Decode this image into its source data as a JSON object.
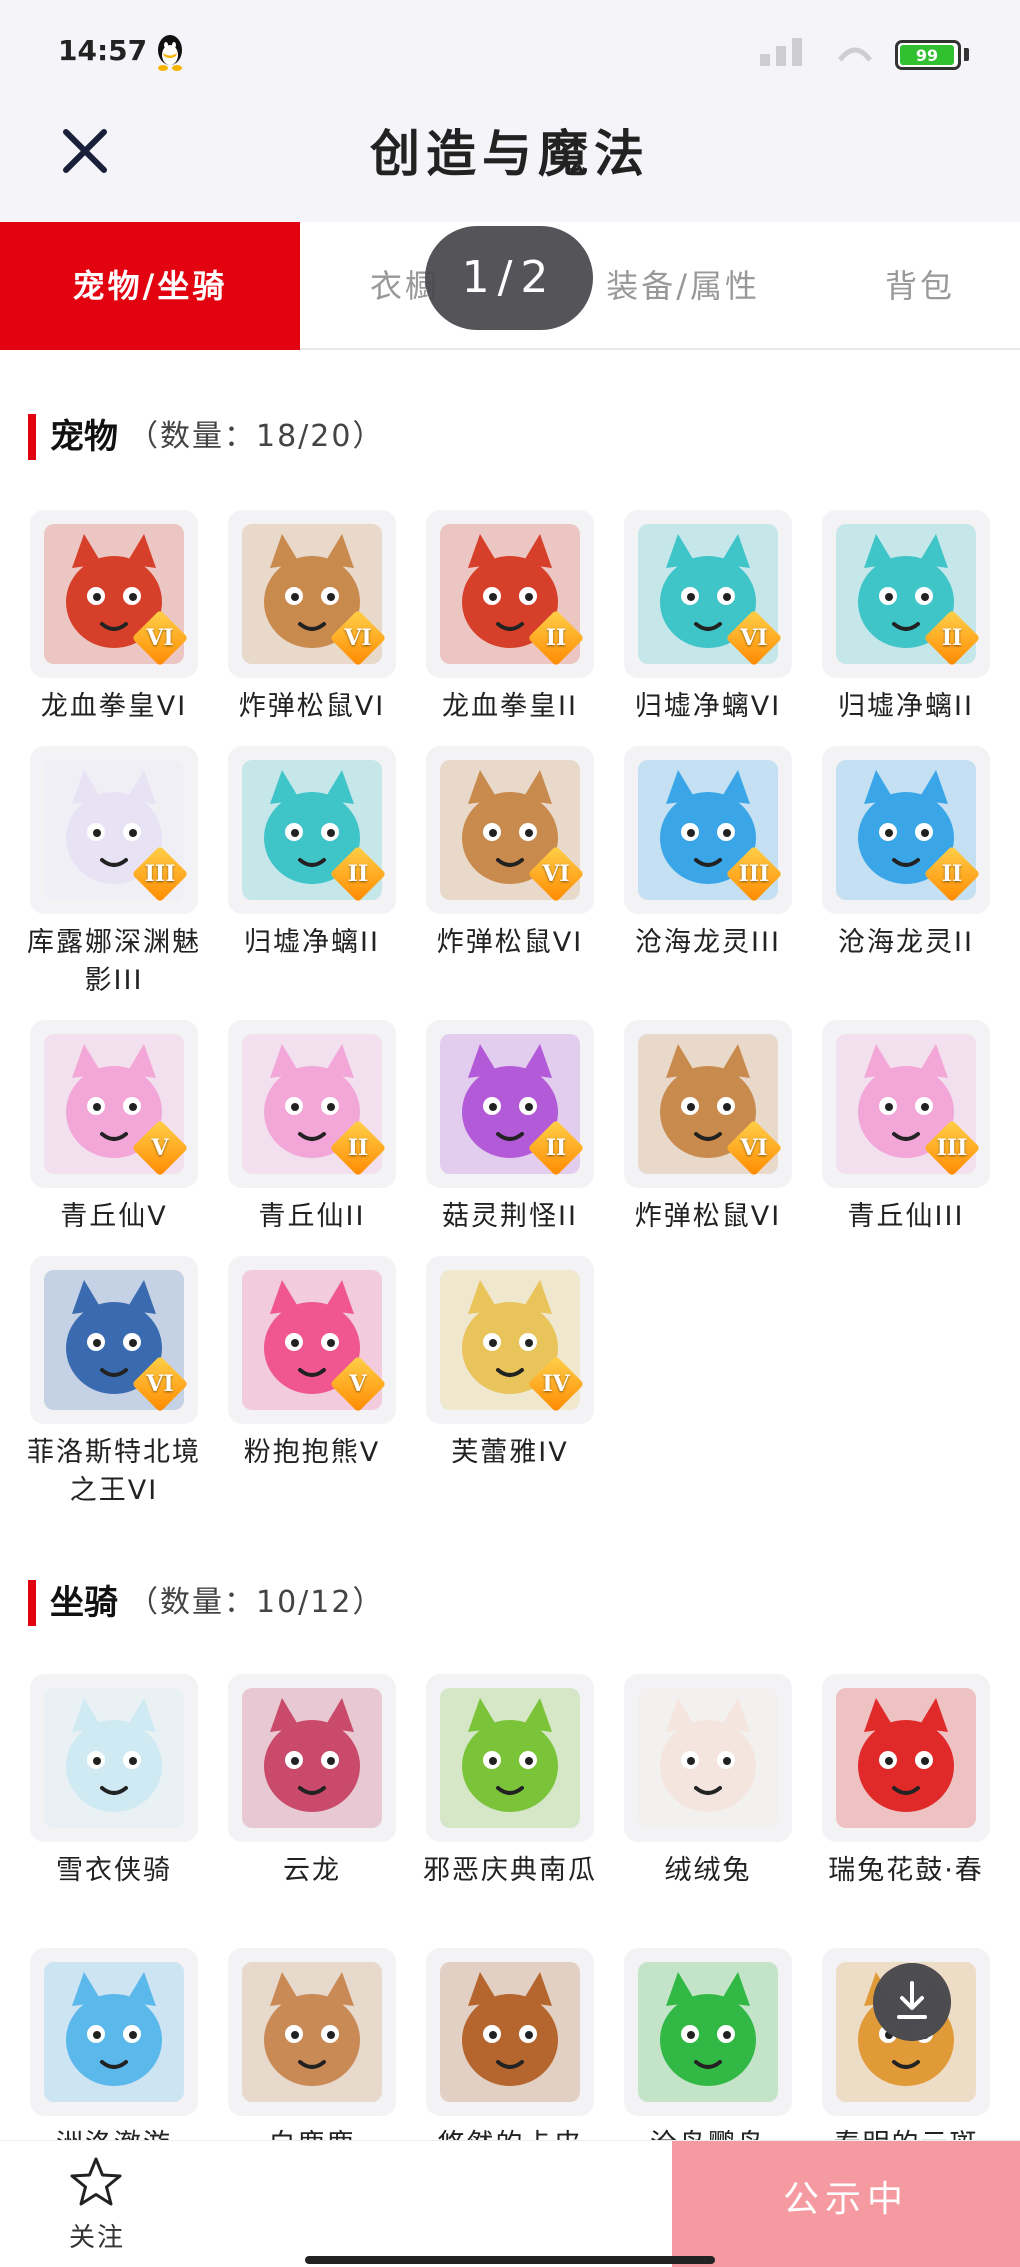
{
  "status_bar": {
    "time": "14:57",
    "battery": "99"
  },
  "header": {
    "title": "创造与魔法"
  },
  "tabs": [
    {
      "label": "宠物/坐骑",
      "active": true
    },
    {
      "label": "衣橱",
      "active": false
    },
    {
      "label": "装备/属性",
      "active": false
    },
    {
      "label": "背包",
      "active": false
    }
  ],
  "page_indicator": "1/2",
  "sections": {
    "pets": {
      "title": "宠物",
      "count": "（数量：18/20）",
      "items": [
        {
          "name": "龙血拳皇VI",
          "badge": "VI",
          "icon": "red-dragon-beast-icon",
          "color": "#d6402a"
        },
        {
          "name": "炸弹松鼠VI",
          "badge": "VI",
          "icon": "bomb-squirrel-icon",
          "color": "#c98a4d"
        },
        {
          "name": "龙血拳皇II",
          "badge": "II",
          "icon": "red-dragon-beast-icon",
          "color": "#d6402a"
        },
        {
          "name": "归墟净螭VI",
          "badge": "VI",
          "icon": "cyan-dragon-icon",
          "color": "#3fc4c8"
        },
        {
          "name": "归墟净螭II",
          "badge": "II",
          "icon": "cyan-dragon-icon",
          "color": "#3fc4c8"
        },
        {
          "name": "库露娜深渊魅影III",
          "badge": "III",
          "icon": "white-sprite-icon",
          "color": "#e8e2f5"
        },
        {
          "name": "归墟净螭II",
          "badge": "II",
          "icon": "cyan-dragon-icon",
          "color": "#3fc4c8"
        },
        {
          "name": "炸弹松鼠VI",
          "badge": "VI",
          "icon": "bomb-squirrel-icon",
          "color": "#c98a4d"
        },
        {
          "name": "沧海龙灵III",
          "badge": "III",
          "icon": "sea-dragon-spirit-icon",
          "color": "#3aa6e8"
        },
        {
          "name": "沧海龙灵II",
          "badge": "II",
          "icon": "sea-dragon-spirit-icon",
          "color": "#3aa6e8"
        },
        {
          "name": "青丘仙V",
          "badge": "V",
          "icon": "fox-fairy-icon",
          "color": "#f2a7d8"
        },
        {
          "name": "青丘仙II",
          "badge": "II",
          "icon": "fox-fairy-icon",
          "color": "#f2a7d8"
        },
        {
          "name": "菇灵荆怪II",
          "badge": "II",
          "icon": "mushroom-spirit-icon",
          "color": "#b25ad8"
        },
        {
          "name": "炸弹松鼠VI",
          "badge": "VI",
          "icon": "bomb-squirrel-icon",
          "color": "#c98a4d"
        },
        {
          "name": "青丘仙III",
          "badge": "III",
          "icon": "fox-fairy-icon",
          "color": "#f2a7d8"
        },
        {
          "name": "菲洛斯特北境之王VI",
          "badge": "VI",
          "icon": "frost-wolf-king-icon",
          "color": "#3a6bb0"
        },
        {
          "name": "粉抱抱熊V",
          "badge": "V",
          "icon": "pink-bear-icon",
          "color": "#f0568f"
        },
        {
          "name": "芙蕾雅IV",
          "badge": "IV",
          "icon": "freya-icon",
          "color": "#e9c45a"
        }
      ]
    },
    "mounts": {
      "title": "坐骑",
      "count": "（数量：10/12）",
      "items": [
        {
          "name": "雪衣侠骑",
          "icon": "white-horse-icon",
          "color": "#cfeaf2"
        },
        {
          "name": "云龙",
          "icon": "cloud-dragon-icon",
          "color": "#c94a6a"
        },
        {
          "name": "邪恶庆典南瓜",
          "icon": "pumpkin-icon",
          "color": "#7bc43a"
        },
        {
          "name": "绒绒兔",
          "icon": "fluffy-rabbit-icon",
          "color": "#f4e6df"
        },
        {
          "name": "瑞兔花鼓·春",
          "icon": "flower-drum-icon",
          "color": "#e02a2a"
        },
        {
          "name": "洲洛澈游",
          "icon": "blue-spirit-icon",
          "color": "#5ab8ea"
        },
        {
          "name": "白鹿鹿",
          "icon": "deer-icon",
          "color": "#c98a55"
        },
        {
          "name": "悠然的卡皮",
          "icon": "capybara-icon",
          "color": "#b5662e"
        },
        {
          "name": "沧鸟鹦鸟",
          "icon": "green-parrot-icon",
          "color": "#32b844"
        },
        {
          "name": "春明的云斑",
          "icon": "eagle-icon",
          "color": "#e09a38"
        }
      ]
    }
  },
  "bottom_bar": {
    "follow_label": "关注",
    "public_button": "公示中"
  }
}
